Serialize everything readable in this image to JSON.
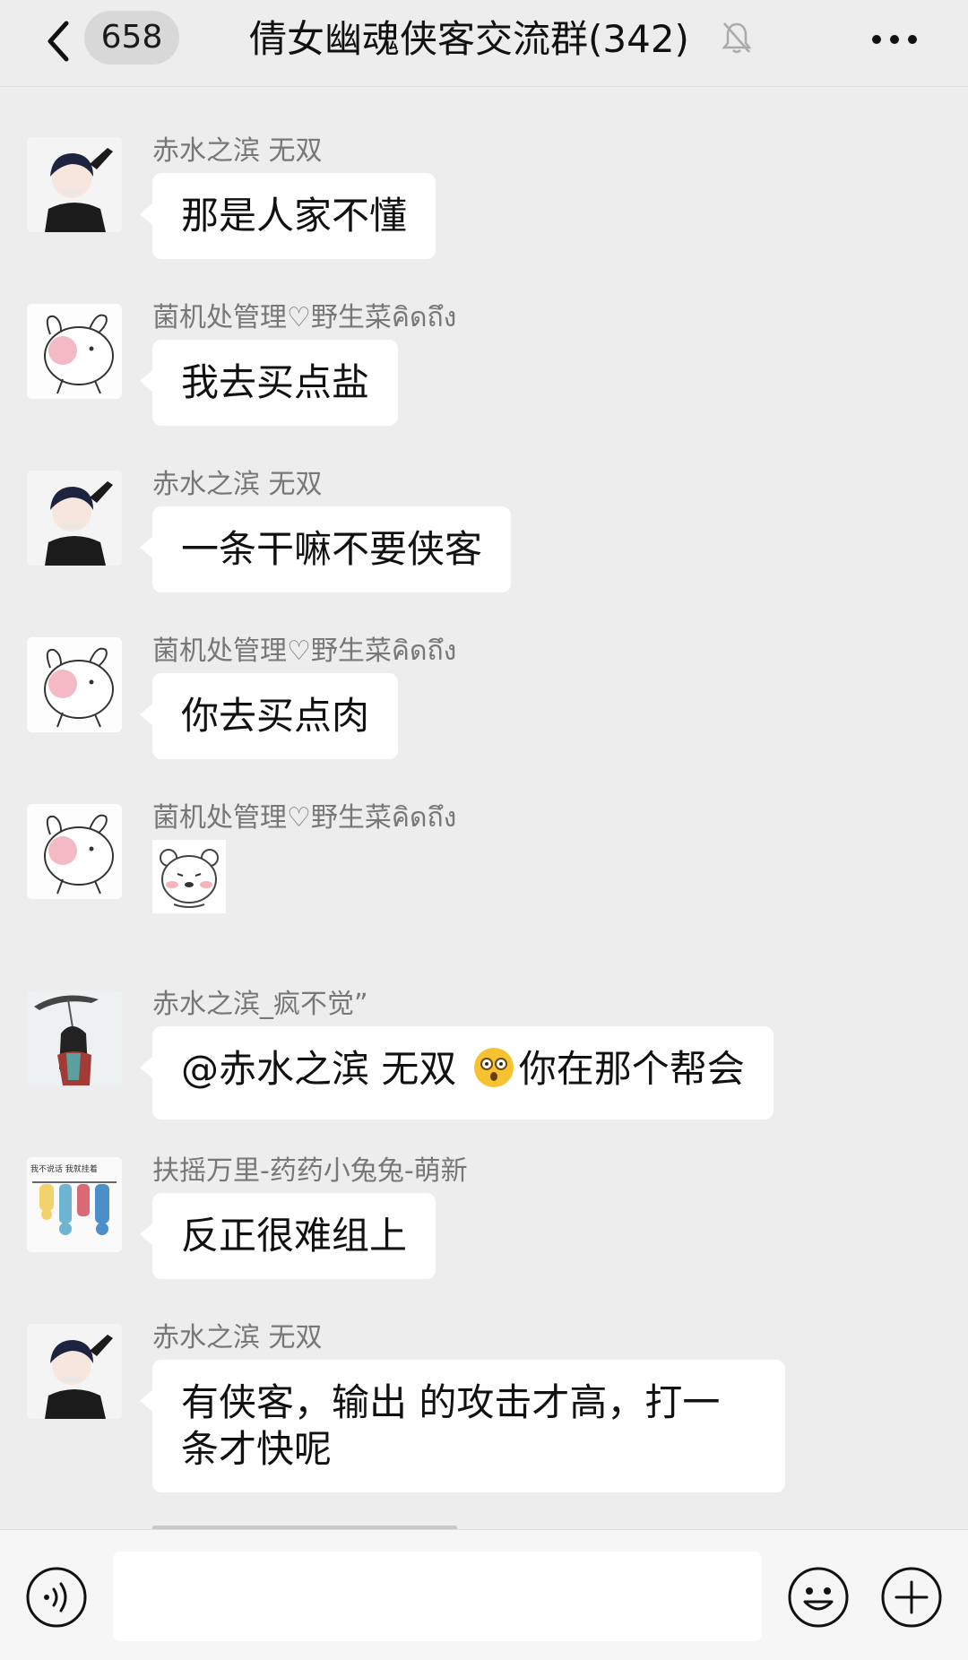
{
  "header": {
    "unread_count": "658",
    "title": "倩女幽魂侠客交流群(342)"
  },
  "messages": [
    {
      "sender": "赤水之滨  无双",
      "text": "那是人家不懂"
    },
    {
      "sender": "菌机处管理♡野生菜คิดถึง",
      "text": "我去买点盐"
    },
    {
      "sender": "赤水之滨  无双",
      "text": "一条干嘛不要侠客"
    },
    {
      "sender": "菌机处管理♡野生菜คิดถึง",
      "text": "你去买点肉"
    },
    {
      "sender": "菌机处管理♡野生菜คิดถึง",
      "sticker": "bear-sticker"
    },
    {
      "sender": "赤水之滨_疯不觉”",
      "text_before": "@赤水之滨  无双 ",
      "emoji": "surprised-face",
      "text_after": "你在那个帮会"
    },
    {
      "sender": "扶摇万里-药药小兔兔-萌新",
      "text": "反正很难组上",
      "avatar_text": "我不说话 我就挂着"
    },
    {
      "sender": "赤水之滨  无双",
      "text": "有侠客，输出 的攻击才高，打一条才快呢"
    }
  ],
  "input": {
    "value": "",
    "placeholder": ""
  },
  "icons": {
    "back": "chevron-left-icon",
    "mute": "bell-slash-icon",
    "more": "ellipsis-icon",
    "voice": "voice-icon",
    "emoji": "smiley-icon",
    "plus": "plus-circle-icon"
  }
}
